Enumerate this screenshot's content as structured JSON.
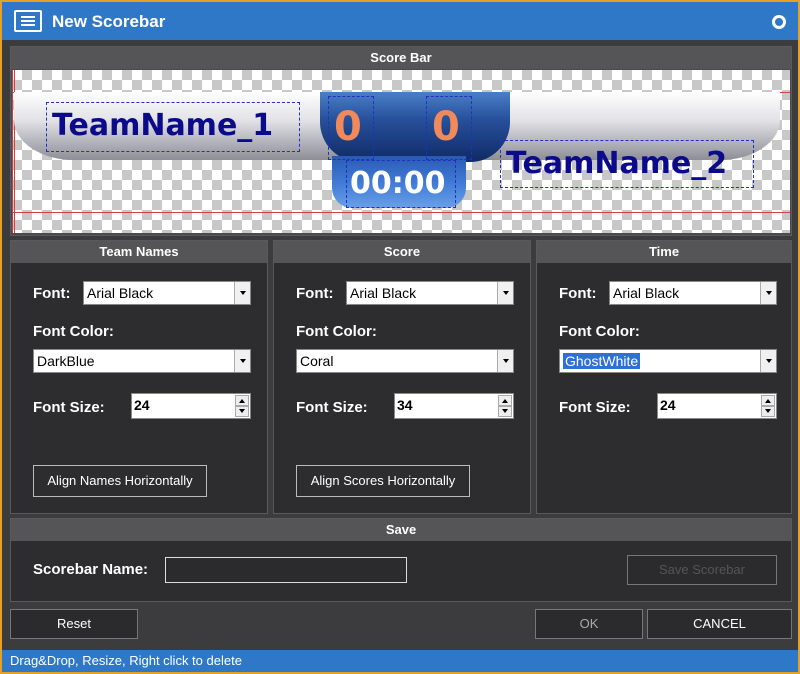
{
  "window": {
    "title": "New Scorebar",
    "title_icon": "list-window-icon",
    "menu_icon": "circle-icon"
  },
  "preview": {
    "header": "Score Bar",
    "team1": "TeamName_1",
    "team2": "TeamName_2",
    "score1": "0",
    "score2": "0",
    "clock": "00:00"
  },
  "team_names": {
    "header": "Team Names",
    "font_label": "Font:",
    "font_value": "Arial Black",
    "color_label": "Font Color:",
    "color_value": "DarkBlue",
    "size_label": "Font Size:",
    "size_value": "24",
    "align_button": "Align Names Horizontally"
  },
  "score": {
    "header": "Score",
    "font_label": "Font:",
    "font_value": "Arial Black",
    "color_label": "Font Color:",
    "color_value": "Coral",
    "size_label": "Font Size:",
    "size_value": "34",
    "align_button": "Align Scores Horizontally"
  },
  "time": {
    "header": "Time",
    "font_label": "Font:",
    "font_value": "Arial Black",
    "color_label": "Font Color:",
    "color_value": "GhostWhite",
    "size_label": "Font Size:",
    "size_value": "24"
  },
  "save": {
    "header": "Save",
    "name_label": "Scorebar Name:",
    "name_value": "",
    "save_button": "Save Scorebar"
  },
  "footer": {
    "reset": "Reset",
    "ok": "OK",
    "cancel": "CANCEL"
  },
  "status": "Drag&Drop,  Resize,  Right click to delete",
  "colors": {
    "titlebar": "#2f78c8",
    "border": "#e8a020",
    "team_name_color": "#0a0a8a",
    "score_color": "#f08a5a",
    "clock_color": "#ffffff"
  }
}
